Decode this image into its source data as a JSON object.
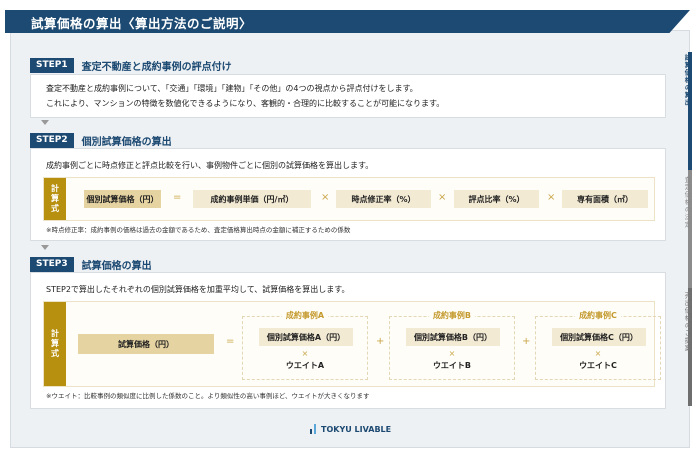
{
  "header": {
    "title": "試算価格の算出〈算出方法のご説明〉"
  },
  "side_tabs": [
    {
      "label": "試算価格の算出",
      "active": true,
      "color": "#1d4a72"
    },
    {
      "label": "査定価格の決定",
      "active": false,
      "color": "#8c8c8c"
    },
    {
      "label": "売出価格のご提案",
      "active": false,
      "color": "#6e6e6e"
    }
  ],
  "step1": {
    "badge": "STEP1",
    "title": "査定不動産と成約事例の評点付け",
    "lines": [
      "査定不動産と成約事例について、「交通」「環境」「建物」「その他」の4つの視点から評点付けをします。",
      "これにより、マンションの特徴を数値化できるようになり、客観的・合理的に比較することが可能になります。"
    ]
  },
  "step2": {
    "badge": "STEP2",
    "title": "個別試算価格の算出",
    "desc": "成約事例ごとに時点修正と評点比較を行い、事例物件ごとに個別の試算価格を算出します。",
    "formula_label": "計算式",
    "terms": [
      "個別試算価格（円）",
      "成約事例単価（円/㎡）",
      "時点修正率（%）",
      "評点比率（%）",
      "専有面積（㎡）"
    ],
    "ops": [
      "=",
      "×",
      "×",
      "×"
    ],
    "note": "※時点修正率：成約事例の価格は過去の金額であるため、査定価格算出時点の金額に補正するための係数"
  },
  "step3": {
    "badge": "STEP3",
    "title": "試算価格の算出",
    "desc": "STEP2で算出したそれぞれの個別試算価格を加重平均して、試算価格を算出します。",
    "formula_label": "計算式",
    "result": "試算価格（円）",
    "equals": "=",
    "plus": "+",
    "times": "×",
    "cases": [
      {
        "label": "成約事例A",
        "price": "個別試算価格A（円）",
        "weight": "ウエイトA"
      },
      {
        "label": "成約事例B",
        "price": "個別試算価格B（円）",
        "weight": "ウエイトB"
      },
      {
        "label": "成約事例C",
        "price": "個別試算価格C（円）",
        "weight": "ウエイトC"
      }
    ],
    "note": "※ウエイト：比較事例の類似度に比例した係数のこと。より類似性の高い事例ほど、ウエイトが大きくなります"
  },
  "footer": {
    "logo": "TOKYU LIVABLE"
  }
}
